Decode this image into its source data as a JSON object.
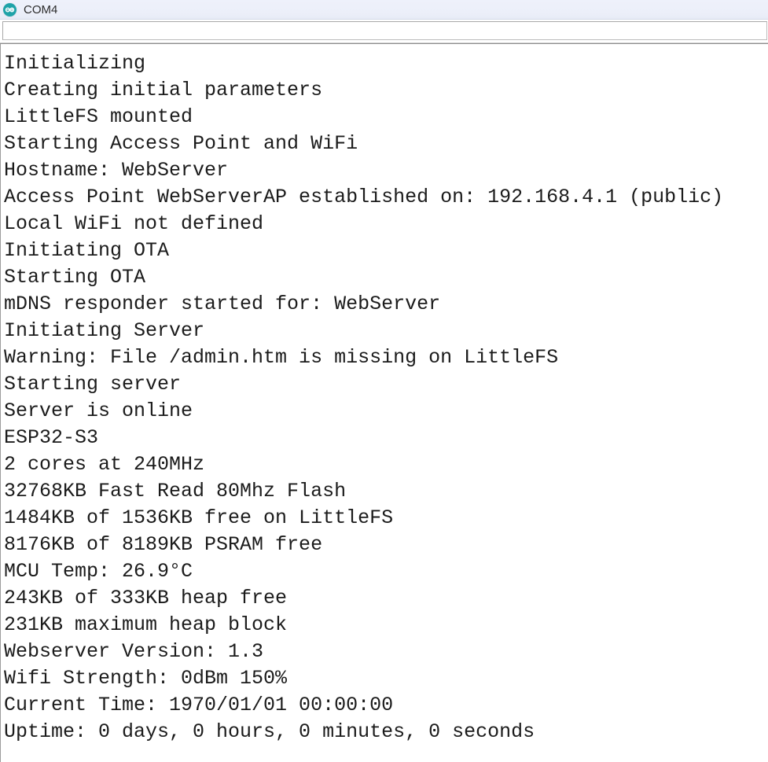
{
  "window": {
    "app": "arduino-serial-monitor",
    "title": "COM4",
    "icon": "arduino-infinity-icon",
    "accent_color": "#1fa3a8",
    "titlebar_color": "#edf1fa",
    "text_color": "#1b1b1b",
    "background_color": "#ffffff"
  },
  "send_field": {
    "value": "",
    "placeholder": ""
  },
  "console": {
    "lines": [
      "Initializing",
      "Creating initial parameters",
      "LittleFS mounted",
      "Starting Access Point and WiFi",
      "Hostname: WebServer",
      "Access Point WebServerAP established on: 192.168.4.1 (public)",
      "Local WiFi not defined",
      "Initiating OTA",
      "Starting OTA",
      "mDNS responder started for: WebServer",
      "Initiating Server",
      "Warning: File /admin.htm is missing on LittleFS",
      "Starting server",
      "Server is online",
      "ESP32-S3",
      "2 cores at 240MHz",
      "32768KB Fast Read 80Mhz Flash",
      "1484KB of 1536KB free on LittleFS",
      "8176KB of 8189KB PSRAM free",
      "MCU Temp: 26.9°C",
      "243KB of 333KB heap free",
      "231KB maximum heap block",
      "Webserver Version: 1.3",
      "Wifi Strength: 0dBm 150%",
      "Current Time: 1970/01/01 00:00:00",
      "Uptime: 0 days, 0 hours, 0 minutes, 0 seconds"
    ],
    "reported_values": {
      "hostname": "WebServer",
      "access_point_name": "WebServerAP",
      "access_point_ip": "192.168.4.1",
      "access_point_visibility": "public",
      "mdns_name": "WebServer",
      "missing_file": "/admin.htm",
      "filesystem": "LittleFS",
      "chip": "ESP32-S3",
      "cores": "2",
      "cpu_frequency": "240MHz",
      "flash_size": "32768KB",
      "flash_mode": "Fast Read 80Mhz",
      "littlefs_free": "1484KB",
      "littlefs_total": "1536KB",
      "psram_free": "8176KB",
      "psram_total": "8189KB",
      "mcu_temp": "26.9°C",
      "heap_free": "243KB",
      "heap_total": "333KB",
      "heap_max_block": "231KB",
      "webserver_version": "1.3",
      "wifi_strength_dbm": "0dBm",
      "wifi_strength_percent": "150%",
      "current_time": "1970/01/01 00:00:00",
      "uptime": "0 days, 0 hours, 0 minutes, 0 seconds"
    }
  }
}
